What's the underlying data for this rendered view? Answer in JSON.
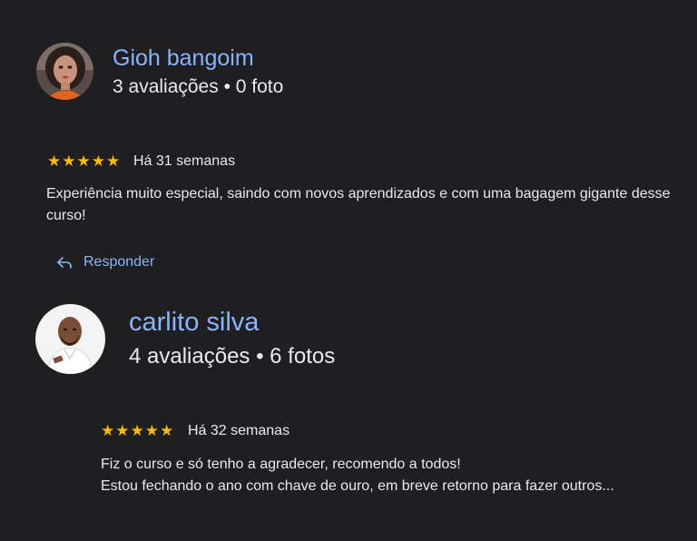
{
  "colors": {
    "background": "#1f1f21",
    "link": "#8ab4f8",
    "text": "#e8eaed",
    "star": "#fbbc04"
  },
  "reviews": [
    {
      "author": "Gioh bangoim",
      "meta": "3 avaliações • 0 foto",
      "rating": 5,
      "stars": "★★★★★",
      "time": "Há 31 semanas",
      "text": "Experiência muito especial, saindo com novos aprendizados e com uma bagagem gigante desse curso!",
      "reply_label": "Responder"
    },
    {
      "author": "carlito silva",
      "meta": "4 avaliações • 6 fotos",
      "rating": 5,
      "stars": "★★★★★",
      "time": "Há 32 semanas",
      "text_line1": "Fiz o curso e só tenho a agradecer, recomendo a todos!",
      "text_line2": "Estou fechando o ano com chave de ouro, em breve retorno para fazer outros..."
    }
  ],
  "icons": {
    "reply": "reply-arrow-icon",
    "star": "star-icon"
  }
}
